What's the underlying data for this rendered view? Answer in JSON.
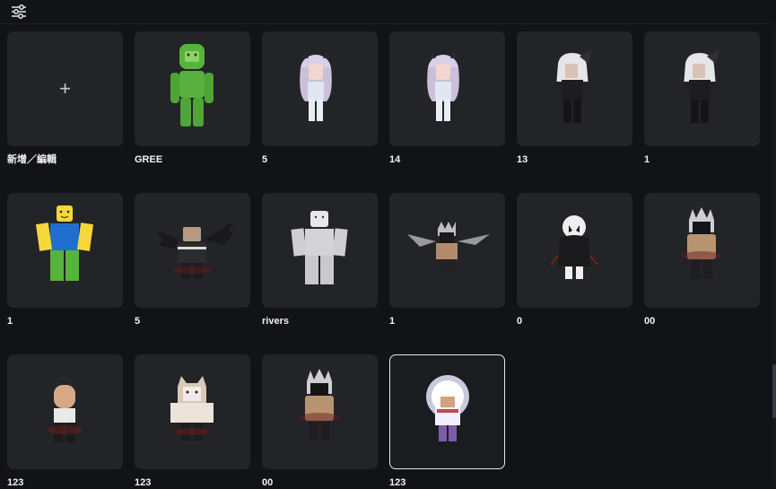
{
  "toolbar": {
    "filter_icon": "sliders-icon"
  },
  "create_card": {
    "label": "新增／編輯",
    "icon": "plus-icon"
  },
  "outfits": [
    {
      "label": "GREE",
      "avatar": "green-classic",
      "selected": false
    },
    {
      "label": "5",
      "avatar": "pastel-anime-girl",
      "selected": false
    },
    {
      "label": "14",
      "avatar": "pastel-anime-girl",
      "selected": false
    },
    {
      "label": "13",
      "avatar": "white-hair-black-outfit",
      "selected": false
    },
    {
      "label": "1",
      "avatar": "white-hair-black-outfit",
      "selected": false
    },
    {
      "label": "1",
      "avatar": "classic-noob",
      "selected": false
    },
    {
      "label": "5",
      "avatar": "winged-box-head",
      "selected": false
    },
    {
      "label": "rivers",
      "avatar": "blank-white",
      "selected": false
    },
    {
      "label": "1",
      "avatar": "winged-horned",
      "selected": false
    },
    {
      "label": "0",
      "avatar": "mask-hooded",
      "selected": false
    },
    {
      "label": "00",
      "avatar": "horned-tan",
      "selected": false
    },
    {
      "label": "123",
      "avatar": "horned-bald",
      "selected": false
    },
    {
      "label": "123",
      "avatar": "cat-head",
      "selected": false
    },
    {
      "label": "00",
      "avatar": "horned-tan",
      "selected": false
    },
    {
      "label": "123",
      "avatar": "white-hair-glow",
      "selected": true
    }
  ],
  "colors": {
    "background": "#121316",
    "card": "#232428",
    "selected_border": "#e6e6e6"
  }
}
